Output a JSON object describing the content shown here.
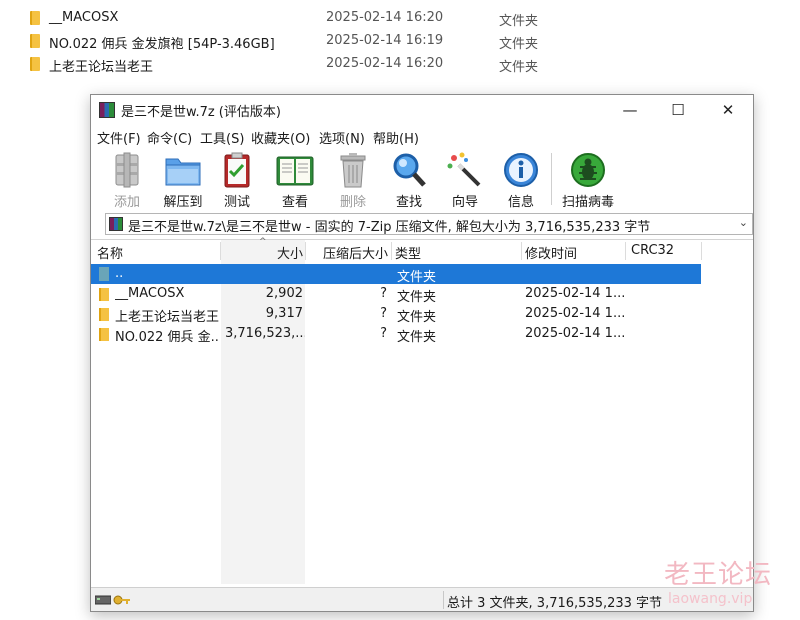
{
  "explorer": {
    "rows": [
      {
        "name": "__MACOSX",
        "date": "2025-02-14 16:20",
        "type": "文件夹"
      },
      {
        "name": "NO.022 佣兵 金发旗袍 [54P-3.46GB]",
        "date": "2025-02-14 16:19",
        "type": "文件夹"
      },
      {
        "name": "上老王论坛当老王",
        "date": "2025-02-14 16:20",
        "type": "文件夹"
      }
    ]
  },
  "window": {
    "title": "是三不是世w.7z (评估版本)",
    "minimize": "—",
    "maximize": "☐",
    "close": "✕"
  },
  "menu": [
    "文件(F)",
    "命令(C)",
    "工具(S)",
    "收藏夹(O)",
    "选项(N)",
    "帮助(H)"
  ],
  "toolbar": [
    {
      "label": "添加",
      "icon": "add-icon",
      "disabled": true
    },
    {
      "label": "解压到",
      "icon": "extract-folder-icon",
      "disabled": false
    },
    {
      "label": "测试",
      "icon": "test-clipboard-icon",
      "disabled": false
    },
    {
      "label": "查看",
      "icon": "view-book-icon",
      "disabled": false
    },
    {
      "label": "删除",
      "icon": "delete-trash-icon",
      "disabled": true
    },
    {
      "label": "查找",
      "icon": "find-magnifier-icon",
      "disabled": false
    },
    {
      "label": "向导",
      "icon": "wizard-wand-icon",
      "disabled": false
    },
    {
      "label": "信息",
      "icon": "info-icon",
      "disabled": false
    },
    {
      "label": "扫描病毒",
      "icon": "virus-scan-icon",
      "disabled": false
    }
  ],
  "path": {
    "text": "是三不是世w.7z\\是三不是世w - 固实的 7-Zip 压缩文件, 解包大小为 3,716,535,233 字节",
    "dropdown": "⌄"
  },
  "columns": {
    "name": "名称",
    "size": "大小",
    "packed": "压缩后大小",
    "type": "类型",
    "modified": "修改时间",
    "crc": "CRC32",
    "sort_indicator": "^"
  },
  "files": [
    {
      "name": "..",
      "size": "",
      "packed": "",
      "type": "文件夹",
      "modified": "",
      "selected": true,
      "up": true
    },
    {
      "name": "__MACOSX",
      "size": "2,902",
      "packed": "?",
      "type": "文件夹",
      "modified": "2025-02-14 1...",
      "selected": false,
      "up": false
    },
    {
      "name": "上老王论坛当老王",
      "size": "9,317",
      "packed": "?",
      "type": "文件夹",
      "modified": "2025-02-14 1...",
      "selected": false,
      "up": false
    },
    {
      "name": "NO.022 佣兵 金...",
      "size": "3,716,523,...",
      "packed": "?",
      "type": "文件夹",
      "modified": "2025-02-14 1...",
      "selected": false,
      "up": false
    }
  ],
  "status": {
    "summary": "总计 3 文件夹, 3,716,535,233 字节"
  },
  "watermark": {
    "cn": "老王论坛",
    "en": "laowang.vip"
  }
}
